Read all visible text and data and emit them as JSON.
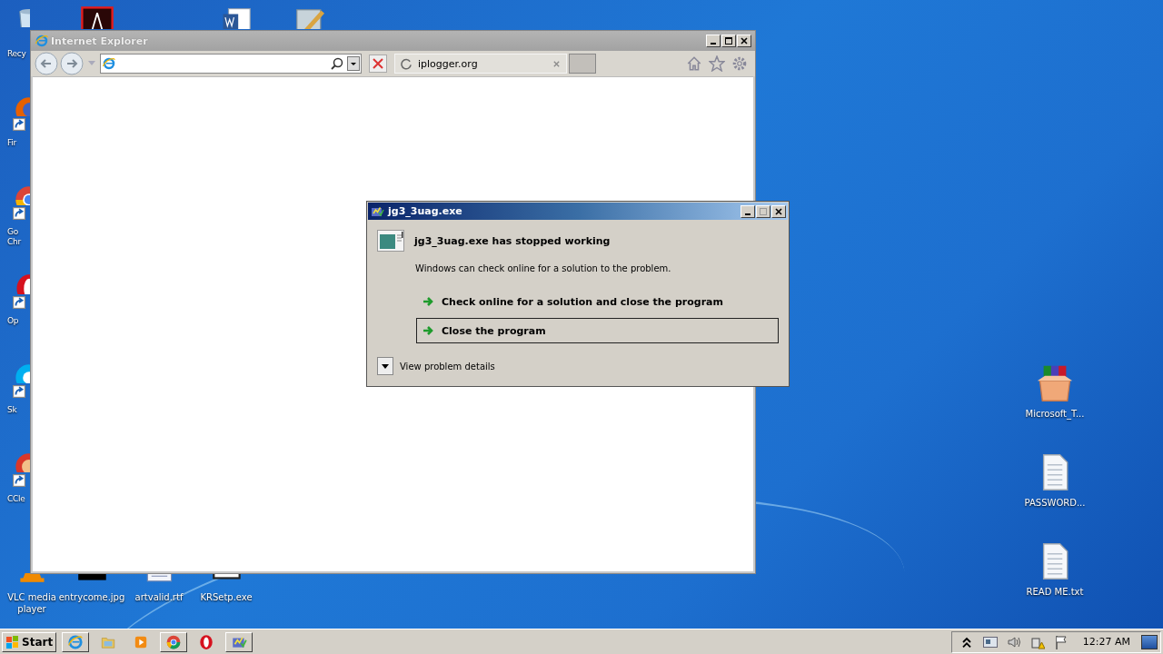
{
  "desktop": {
    "left_icons": [
      {
        "kind": "bin",
        "label": "Recy"
      },
      {
        "kind": "firefox",
        "label": "Fir"
      },
      {
        "kind": "chrome",
        "label": "Go Chr"
      },
      {
        "kind": "opera",
        "label": "Op"
      },
      {
        "kind": "skype",
        "label": "Sk"
      },
      {
        "kind": "ccleaner",
        "label": "CCle"
      }
    ],
    "top_icons": [
      {
        "kind": "pdf"
      },
      {
        "kind": "word"
      },
      {
        "kind": "notepad"
      }
    ],
    "bottom_icons": [
      {
        "kind": "vlc",
        "label": "VLC media player"
      },
      {
        "kind": "jpg",
        "label": "entrycome.jpg"
      },
      {
        "kind": "rtf",
        "label": "artvalid.rtf"
      },
      {
        "kind": "exe",
        "label": "KRSetp.exe"
      }
    ],
    "right_icons": [
      {
        "kind": "archive",
        "label": "Microsoft_T..."
      },
      {
        "kind": "txt",
        "label": "PASSWORD..."
      },
      {
        "kind": "txt",
        "label": "READ ME.txt"
      }
    ]
  },
  "browser_window": {
    "title": "Internet Explorer",
    "tab": {
      "title": "iplogger.org",
      "loading": true
    }
  },
  "dialog": {
    "title": "jg3_3uag.exe",
    "heading": "jg3_3uag.exe has stopped working",
    "message": "Windows can check online for a solution to the problem.",
    "options": [
      {
        "label": "Check online for a solution and close the program",
        "selected": false
      },
      {
        "label": "Close the program",
        "selected": true
      }
    ],
    "details_toggle": "View problem details"
  },
  "taskbar": {
    "start": "Start",
    "apps": [
      {
        "kind": "ie"
      },
      {
        "kind": "folder"
      },
      {
        "kind": "media"
      },
      {
        "kind": "chrome"
      },
      {
        "kind": "opera"
      },
      {
        "kind": "crash"
      }
    ],
    "clock": "12:27 AM"
  }
}
